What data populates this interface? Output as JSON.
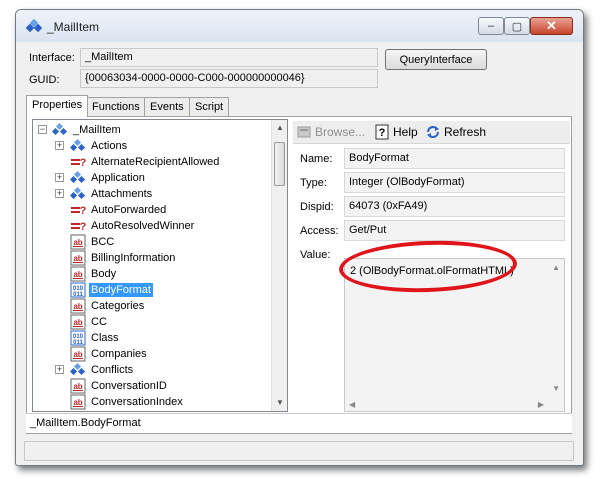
{
  "window": {
    "title": "_MailItem",
    "icon": "object-cubes-icon",
    "controls": {
      "minimize": "–",
      "maximize": "▢",
      "close": "✕"
    }
  },
  "header": {
    "interface_label": "Interface:",
    "interface_value": "_MailItem",
    "guid_label": "GUID:",
    "guid_value": "{00063034-0000-0000-C000-000000000046}",
    "query_button": "QueryInterface"
  },
  "tabs": [
    {
      "label": "Properties",
      "active": true
    },
    {
      "label": "Functions",
      "active": false
    },
    {
      "label": "Events",
      "active": false
    },
    {
      "label": "Script",
      "active": false
    }
  ],
  "tree": {
    "root": {
      "label": "_MailItem",
      "expander": "−",
      "icon": "object-cubes-icon"
    },
    "items": [
      {
        "label": "Actions",
        "icon": "object-cubes-icon",
        "expander": "+"
      },
      {
        "label": "AlternateRecipientAllowed",
        "icon": "boolean-icon",
        "expander": ""
      },
      {
        "label": "Application",
        "icon": "object-cubes-icon",
        "expander": "+"
      },
      {
        "label": "Attachments",
        "icon": "object-cubes-icon",
        "expander": "+"
      },
      {
        "label": "AutoForwarded",
        "icon": "boolean-icon",
        "expander": ""
      },
      {
        "label": "AutoResolvedWinner",
        "icon": "boolean-icon",
        "expander": ""
      },
      {
        "label": "BCC",
        "icon": "string-icon",
        "expander": ""
      },
      {
        "label": "BillingInformation",
        "icon": "string-icon",
        "expander": ""
      },
      {
        "label": "Body",
        "icon": "string-icon",
        "expander": ""
      },
      {
        "label": "BodyFormat",
        "icon": "integer-icon",
        "expander": "",
        "selected": true
      },
      {
        "label": "Categories",
        "icon": "string-icon",
        "expander": ""
      },
      {
        "label": "CC",
        "icon": "string-icon",
        "expander": ""
      },
      {
        "label": "Class",
        "icon": "integer-icon",
        "expander": ""
      },
      {
        "label": "Companies",
        "icon": "string-icon",
        "expander": ""
      },
      {
        "label": "Conflicts",
        "icon": "object-cubes-icon",
        "expander": "+"
      },
      {
        "label": "ConversationID",
        "icon": "string-icon",
        "expander": ""
      },
      {
        "label": "ConversationIndex",
        "icon": "string-icon",
        "expander": ""
      }
    ]
  },
  "toolbar": {
    "browse": "Browse...",
    "help": "Help",
    "refresh": "Refresh"
  },
  "details": {
    "name_label": "Name:",
    "name_value": "BodyFormat",
    "type_label": "Type:",
    "type_value": "Integer (OlBodyFormat)",
    "dispid_label": "Dispid:",
    "dispid_value": "64073  (0xFA49)",
    "access_label": "Access:",
    "access_value": "Get/Put",
    "value_label": "Value:",
    "value_value": "2 (OlBodyFormat.olFormatHTML)"
  },
  "status": {
    "text": "_MailItem.BodyFormat"
  },
  "colors": {
    "selection": "#3399ff",
    "highlight_ellipse": "#e0151b",
    "icon_blue": "#2a62c9",
    "icon_red": "#c0282a"
  }
}
